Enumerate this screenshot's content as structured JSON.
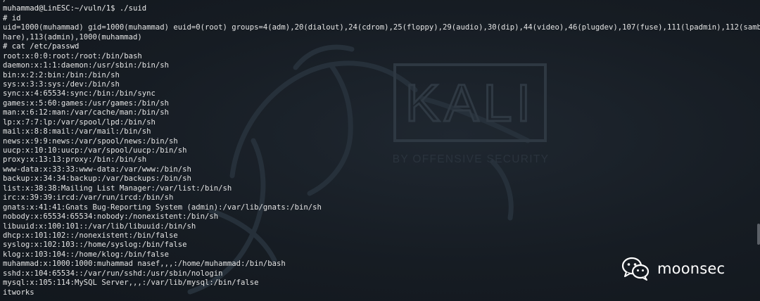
{
  "terminal": {
    "lines": [
      "/",
      "muhammad@LinESC:~/vuln/1$ ./suid",
      "# id",
      "uid=1000(muhammad) gid=1000(muhammad) euid=0(root) groups=4(adm),20(dialout),24(cdrom),25(floppy),29(audio),30(dip),44(video),46(plugdev),107(fuse),111(lpadmin),112(sambas",
      "hare),113(admin),1000(muhammad)",
      "# cat /etc/passwd",
      "root:x:0:0:root:/root:/bin/bash",
      "daemon:x:1:1:daemon:/usr/sbin:/bin/sh",
      "bin:x:2:2:bin:/bin:/bin/sh",
      "sys:x:3:3:sys:/dev:/bin/sh",
      "sync:x:4:65534:sync:/bin:/bin/sync",
      "games:x:5:60:games:/usr/games:/bin/sh",
      "man:x:6:12:man:/var/cache/man:/bin/sh",
      "lp:x:7:7:lp:/var/spool/lpd:/bin/sh",
      "mail:x:8:8:mail:/var/mail:/bin/sh",
      "news:x:9:9:news:/var/spool/news:/bin/sh",
      "uucp:x:10:10:uucp:/var/spool/uucp:/bin/sh",
      "proxy:x:13:13:proxy:/bin:/bin/sh",
      "www-data:x:33:33:www-data:/var/www:/bin/sh",
      "backup:x:34:34:backup:/var/backups:/bin/sh",
      "list:x:38:38:Mailing List Manager:/var/list:/bin/sh",
      "irc:x:39:39:ircd:/var/run/ircd:/bin/sh",
      "gnats:x:41:41:Gnats Bug-Reporting System (admin):/var/lib/gnats:/bin/sh",
      "nobody:x:65534:65534:nobody:/nonexistent:/bin/sh",
      "libuuid:x:100:101::/var/lib/libuuid:/bin/sh",
      "dhcp:x:101:102::/nonexistent:/bin/false",
      "syslog:x:102:103::/home/syslog:/bin/false",
      "klog:x:103:104::/home/klog:/bin/false",
      "muhammad:x:1000:1000:muhammad nasef,,,:/home/muhammad:/bin/bash",
      "sshd:x:104:65534::/var/run/sshd:/usr/sbin/nologin",
      "mysql:x:105:114:MySQL Server,,,:/var/lib/mysql:/bin/false",
      "itworks"
    ]
  },
  "wallpaper": {
    "logo_text": "KALI",
    "tagline": "BY OFFENSIVE SECURITY"
  },
  "watermark": {
    "icon": "wechat-icon",
    "text": "moonsec"
  },
  "colors": {
    "background": "#161c23",
    "text": "#e4e4e4",
    "wallpaper_mark": "#2d3640"
  }
}
